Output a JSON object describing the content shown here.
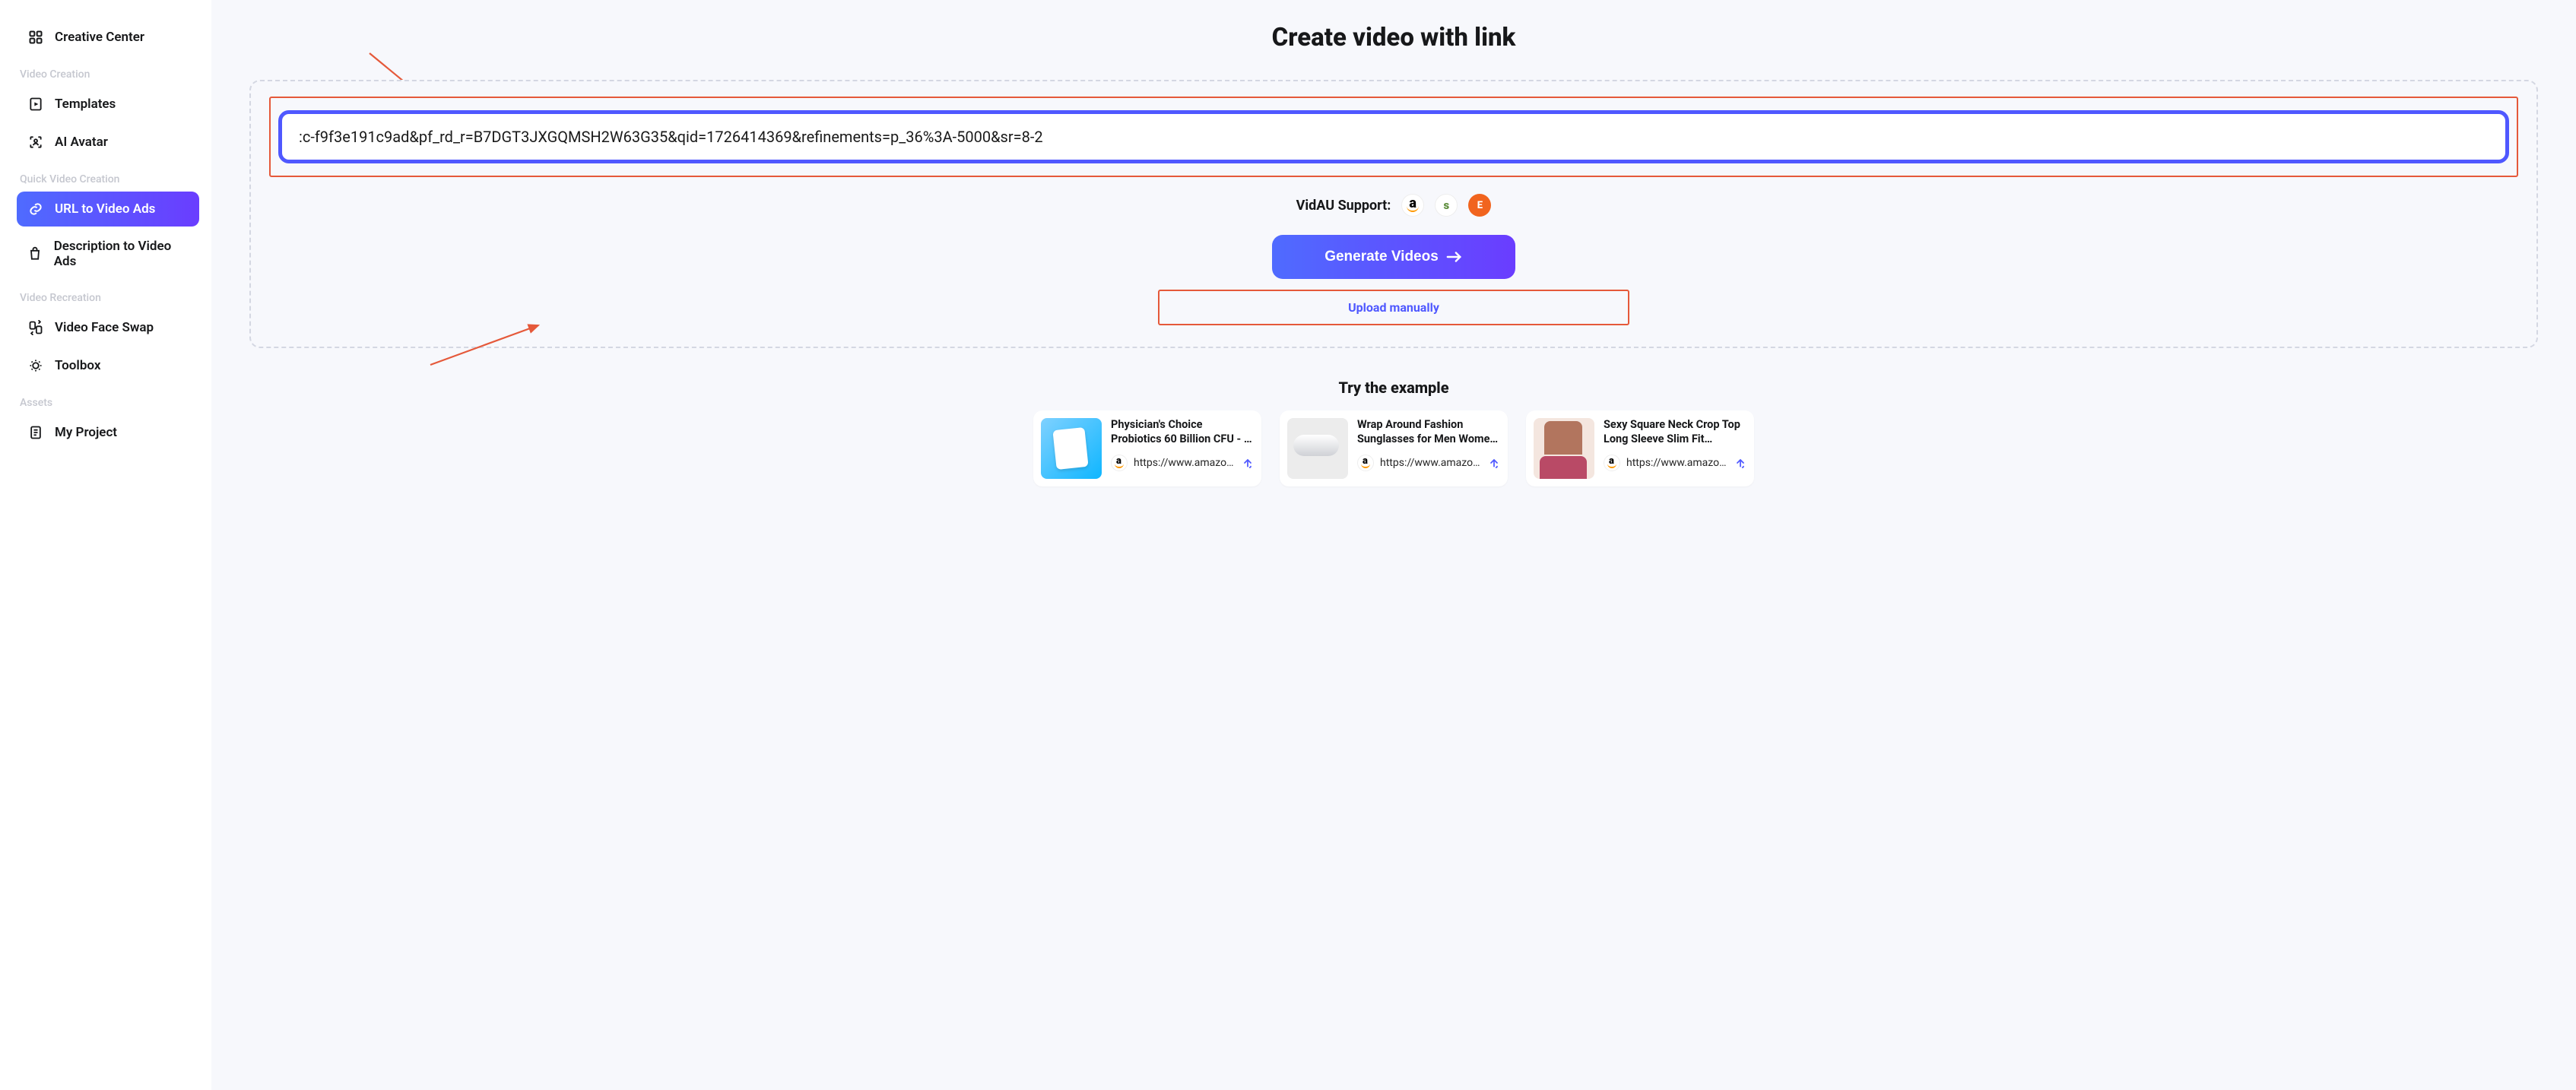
{
  "sidebar": {
    "top": {
      "label": "Creative Center"
    },
    "sections": [
      {
        "label": "Video Creation",
        "items": [
          {
            "label": "Templates"
          },
          {
            "label": "AI Avatar"
          }
        ]
      },
      {
        "label": "Quick Video Creation",
        "items": [
          {
            "label": "URL to Video Ads",
            "active": true
          },
          {
            "label": "Description to Video Ads"
          }
        ]
      },
      {
        "label": "Video Recreation",
        "items": [
          {
            "label": "Video Face Swap"
          },
          {
            "label": "Toolbox"
          }
        ]
      },
      {
        "label": "Assets",
        "items": [
          {
            "label": "My Project"
          }
        ]
      }
    ]
  },
  "main": {
    "title": "Create video with link",
    "url_value": ":c-f9f3e191c9ad&pf_rd_r=B7DGT3JXGQMSH2W63G35&qid=1726414369&refinements=p_36%3A-5000&sr=8-2",
    "support_label": "VidAU Support:",
    "support_platforms": [
      "amazon",
      "shopify",
      "etsy"
    ],
    "generate_label": "Generate Videos",
    "upload_label": "Upload manually",
    "examples_title": "Try the example",
    "examples": [
      {
        "title": "Physician's Choice Probiotics 60 Billion CFU - …",
        "url_display": "https://www.amazo…",
        "thumb": "blue"
      },
      {
        "title": "Wrap Around Fashion Sunglasses for Men Wome…",
        "url_display": "https://www.amazo…",
        "thumb": "grey"
      },
      {
        "title": "Sexy Square Neck Crop Top Long Sleeve Slim Fit…",
        "url_display": "https://www.amazo…",
        "thumb": "skin"
      }
    ]
  }
}
